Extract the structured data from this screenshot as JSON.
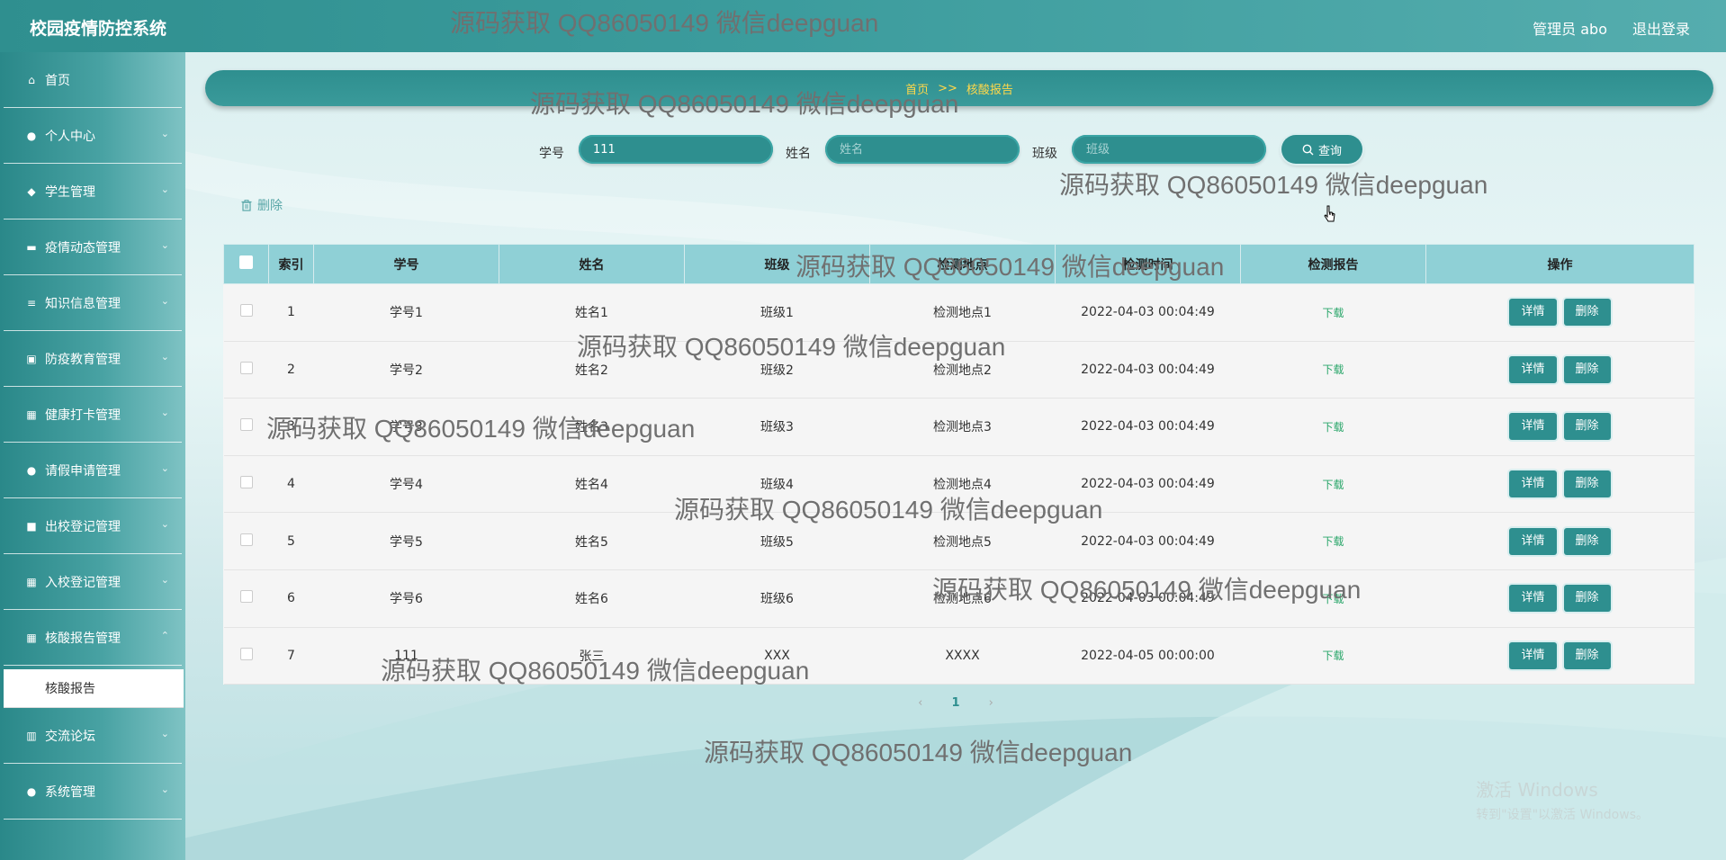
{
  "app": {
    "title": "校园疫情防控系统"
  },
  "header": {
    "user_label": "管理员 abo",
    "logout_label": "退出登录"
  },
  "sidebar": {
    "items": [
      {
        "label": "首页",
        "icon": "home-icon",
        "glyph": "⌂"
      },
      {
        "label": "个人中心",
        "icon": "user-icon",
        "glyph": "●"
      },
      {
        "label": "学生管理",
        "icon": "student-icon",
        "glyph": "◆"
      },
      {
        "label": "疫情动态管理",
        "icon": "monitor-icon",
        "glyph": "▬"
      },
      {
        "label": "知识信息管理",
        "icon": "list-icon",
        "glyph": "≡"
      },
      {
        "label": "防疫教育管理",
        "icon": "calendar-icon",
        "glyph": "▣"
      },
      {
        "label": "健康打卡管理",
        "icon": "grid-icon",
        "glyph": "▦"
      },
      {
        "label": "请假申请管理",
        "icon": "user-icon",
        "glyph": "●"
      },
      {
        "label": "出校登记管理",
        "icon": "chat-icon",
        "glyph": "■"
      },
      {
        "label": "入校登记管理",
        "icon": "grid-icon",
        "glyph": "▦"
      },
      {
        "label": "核酸报告管理",
        "icon": "grid-icon",
        "glyph": "▦"
      },
      {
        "label": "交流论坛",
        "icon": "chart-icon",
        "glyph": "▥"
      },
      {
        "label": "系统管理",
        "icon": "pin-icon",
        "glyph": "●"
      }
    ],
    "sub_item": "核酸报告"
  },
  "breadcrumb": {
    "home": "首页",
    "sep": ">>",
    "current": "核酸报告"
  },
  "search": {
    "student_id_label": "学号",
    "student_id_value": "111",
    "name_label": "姓名",
    "name_placeholder": "姓名",
    "class_label": "班级",
    "class_placeholder": "班级",
    "query_label": "查询"
  },
  "delete_label": "删除",
  "table": {
    "columns": [
      "索引",
      "学号",
      "姓名",
      "班级",
      "检测地点",
      "检测时间",
      "检测报告",
      "操作"
    ],
    "download_label": "下载",
    "detail_label": "详情",
    "delete_label": "删除",
    "rows": [
      {
        "index": "1",
        "student_id": "学号1",
        "name": "姓名1",
        "class": "班级1",
        "location": "检测地点1",
        "time": "2022-04-03 00:04:49"
      },
      {
        "index": "2",
        "student_id": "学号2",
        "name": "姓名2",
        "class": "班级2",
        "location": "检测地点2",
        "time": "2022-04-03 00:04:49"
      },
      {
        "index": "3",
        "student_id": "学号3",
        "name": "姓名3",
        "class": "班级3",
        "location": "检测地点3",
        "time": "2022-04-03 00:04:49"
      },
      {
        "index": "4",
        "student_id": "学号4",
        "name": "姓名4",
        "class": "班级4",
        "location": "检测地点4",
        "time": "2022-04-03 00:04:49"
      },
      {
        "index": "5",
        "student_id": "学号5",
        "name": "姓名5",
        "class": "班级5",
        "location": "检测地点5",
        "time": "2022-04-03 00:04:49"
      },
      {
        "index": "6",
        "student_id": "学号6",
        "name": "姓名6",
        "class": "班级6",
        "location": "检测地点6",
        "time": "2022-04-03 00:04:49"
      },
      {
        "index": "7",
        "student_id": "111",
        "name": "张三",
        "class": "XXX",
        "location": "XXXX",
        "time": "2022-04-05 00:00:00"
      }
    ]
  },
  "pager": {
    "prev": "‹",
    "current": "1",
    "next": "›"
  },
  "watermark": "源码获取 QQ86050149 微信deepguan",
  "activate": {
    "line1": "激活 Windows",
    "line2": "转到\"设置\"以激活 Windows。"
  },
  "colors": {
    "primary": "#2e8f8f",
    "header_row": "#8fd0d6",
    "download": "#2aa66a",
    "breadcrumb_text": "#ffd84a"
  }
}
